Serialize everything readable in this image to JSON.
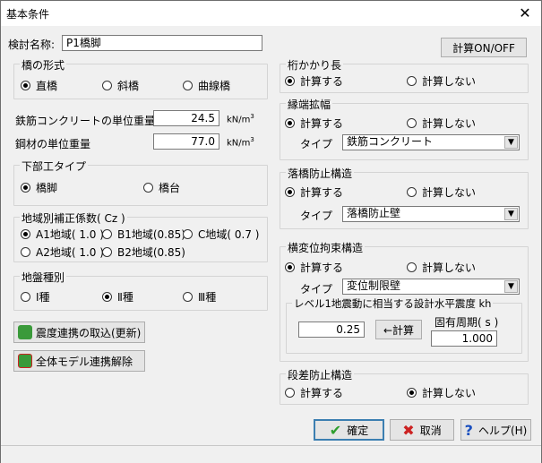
{
  "window": {
    "title": "基本条件",
    "close": "✕"
  },
  "case_name": {
    "label": "検討名称:",
    "value": "P1橋脚"
  },
  "calc_toggle": "計算ON/OFF",
  "bridge_type": {
    "title": "橋の形式",
    "options": [
      "直橋",
      "斜橋",
      "曲線橋"
    ],
    "selected": 0
  },
  "rebar_weight": {
    "label": "鉄筋コンクリートの単位重量",
    "value": "24.5",
    "unit": "kN/m",
    "unit_sup": "3"
  },
  "steel_weight": {
    "label": "鋼材の単位重量",
    "value": "77.0",
    "unit": "kN/m",
    "unit_sup": "3"
  },
  "substructure": {
    "title": "下部工タイプ",
    "options": [
      "橋脚",
      "橋台"
    ],
    "selected": 0
  },
  "region": {
    "title": "地域別補正係数( Cz )",
    "options": [
      "A1地域( 1.0 )",
      "B1地域(0.85)",
      "C地域( 0.7 )",
      "A2地域( 1.0 )",
      "B2地域(0.85)"
    ],
    "selected": 0
  },
  "ground": {
    "title": "地盤種別",
    "options": [
      "Ⅰ種",
      "Ⅱ種",
      "Ⅲ種"
    ],
    "selected": 1
  },
  "btn_import": "震度連携の取込(更新)",
  "btn_unlink": "全体モデル連携解除",
  "girder_seat": {
    "title": "桁かかり長",
    "options": [
      "計算する",
      "計算しない"
    ],
    "selected": 0
  },
  "edge_widening": {
    "title": "縁端拡幅",
    "options": [
      "計算する",
      "計算しない"
    ],
    "selected": 0,
    "type_label": "タイプ",
    "type_value": "鉄筋コンクリート"
  },
  "fall_prevention": {
    "title": "落橋防止構造",
    "options": [
      "計算する",
      "計算しない"
    ],
    "selected": 0,
    "type_label": "タイプ",
    "type_value": "落橋防止壁"
  },
  "lateral_restraint": {
    "title": "横変位拘束構造",
    "options": [
      "計算する",
      "計算しない"
    ],
    "selected": 0,
    "type_label": "タイプ",
    "type_value": "変位制限壁",
    "seismic_title": "レベル1地震動に相当する設計水平震度 kh",
    "kh_value": "0.25",
    "calc_button": "←計算",
    "period_label": "固有周期( s )",
    "period_value": "1.000"
  },
  "step_prevention": {
    "title": "段差防止構造",
    "options": [
      "計算する",
      "計算しない"
    ],
    "selected": 1
  },
  "footer": {
    "ok": "確定",
    "cancel": "取消",
    "help": "ヘルプ(H)"
  },
  "colors": {
    "ok_check": "#2e9e2e",
    "cancel_x": "#cc2222",
    "help_q": "#1a4fbf",
    "icon_green": "#3a9a3a"
  }
}
